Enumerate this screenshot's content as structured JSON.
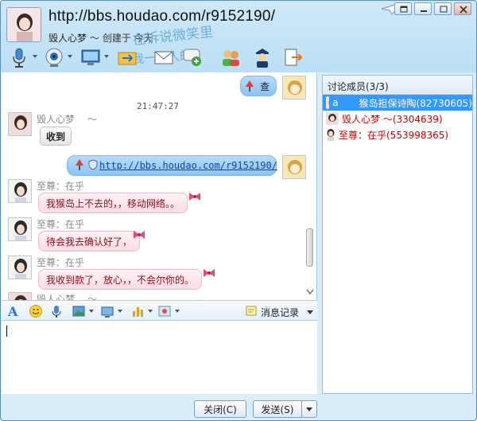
{
  "header": {
    "title": "http://bbs.houdao.com/r9152190/",
    "name": "毁人心梦",
    "signature": "～ 创建于 今天",
    "deco_line1": "在诉说微笑里",
    "deco_line2": "我一个人的"
  },
  "toolbar": {
    "icons": [
      "microphone-icon",
      "camera-icon",
      "screen-share-icon",
      "file-transfer-icon",
      "mail-icon",
      "chat-add-icon",
      "group-icon",
      "police-icon",
      "exit-icon"
    ]
  },
  "chat": {
    "timestamp": "21:47:27",
    "messages": [
      {
        "sender": "me",
        "text": "查"
      },
      {
        "sender": "毁人心梦",
        "tilde": "～",
        "text": "收到"
      },
      {
        "sender": "me",
        "text": "http://bbs.houdao.com/r9152190/"
      },
      {
        "sender": "至尊：在乎",
        "text": "我猴岛上不去的，，移动网络。。"
      },
      {
        "sender": "至尊：在乎",
        "text": "待会我去确认好了，"
      },
      {
        "sender": "至尊：在乎",
        "text": "我收到款了，放心，，不会尔你的。"
      },
      {
        "sender": "毁人心梦",
        "tilde": "～",
        "text": ""
      }
    ]
  },
  "input_toolbar": {
    "history_label": "消息记录"
  },
  "buttons": {
    "close": "关闭(C)",
    "send": "发送(S)"
  },
  "members": {
    "header": "讨论成员(3/3)",
    "list": [
      {
        "prefix": "a",
        "name": "猴岛担保诗陶(82730605)",
        "selected": true,
        "color": "#ffffff"
      },
      {
        "prefix": "",
        "name": "毁人心梦 ～(3304639)",
        "selected": false,
        "color": "#cc0000"
      },
      {
        "prefix": "",
        "name": "至尊：在乎(553998365)",
        "selected": false,
        "color": "#cc0000"
      }
    ]
  }
}
